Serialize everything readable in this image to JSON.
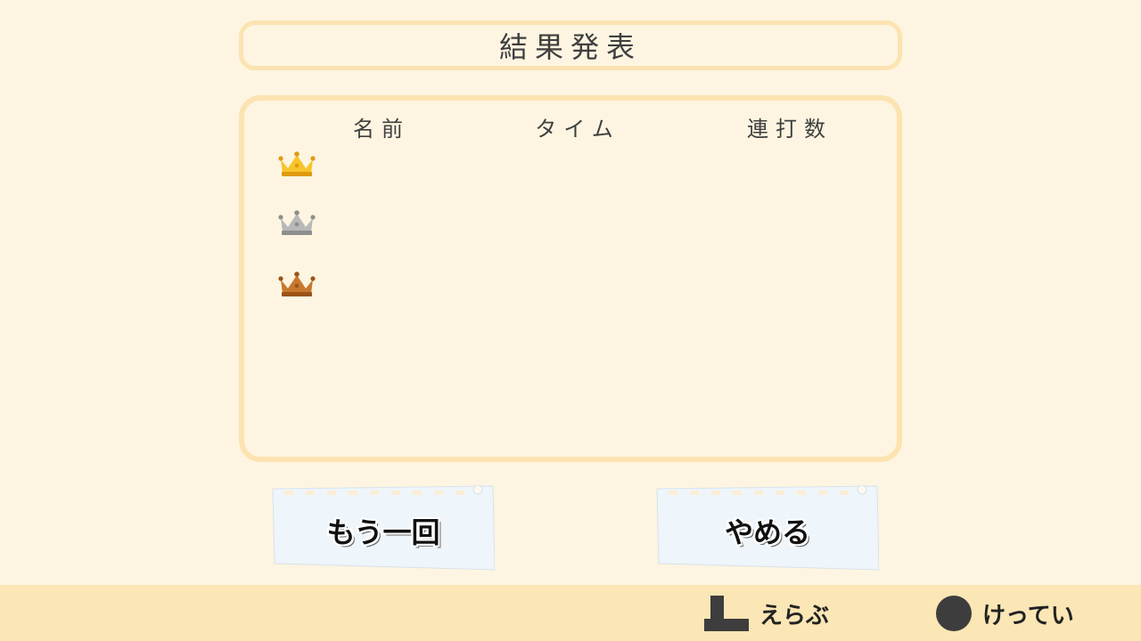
{
  "title": "結果発表",
  "columns": {
    "name": "名前",
    "time": "タイム",
    "count": "連打数"
  },
  "ranks": [
    {
      "icon": "gold-crown-icon",
      "color": "#f7c52a",
      "dark": "#e19a12"
    },
    {
      "icon": "silver-crown-icon",
      "color": "#b8b8b8",
      "dark": "#8e8e8e"
    },
    {
      "icon": "bronze-crown-icon",
      "color": "#c8782e",
      "dark": "#9a5418"
    }
  ],
  "buttons": {
    "retry": "もう一回",
    "quit": "やめる"
  },
  "controls": {
    "select": "えらぶ",
    "confirm": "けってい"
  }
}
